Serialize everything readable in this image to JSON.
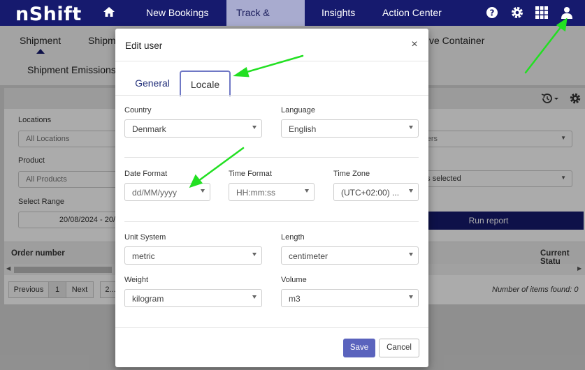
{
  "app": {
    "logo": "nShift"
  },
  "nav": {
    "home_icon": "home-icon",
    "items": [
      {
        "label": "New Bookings"
      },
      {
        "label": "Track & Trace",
        "active": true
      },
      {
        "label": "Insights"
      },
      {
        "label": "Action Center"
      }
    ],
    "right_icons": [
      "help-icon",
      "gear-icon",
      "apps-grid-icon",
      "user-icon"
    ]
  },
  "subnav": {
    "tabs": [
      "Shipment",
      "Shipm",
      "ve Container",
      "Shipment Emissions"
    ]
  },
  "filters": {
    "locations_label": "Locations",
    "locations_value": "All Locations",
    "product_label": "Product",
    "product_value": "All Products",
    "range_label": "Select Range",
    "range_value": "20/08/2024 - 20/",
    "carriers_value": "rriers",
    "items_value": "ms selected",
    "run_label": "Run report"
  },
  "table": {
    "col_order": "Order number",
    "col_status": "Current Statu"
  },
  "pager": {
    "previous": "Previous",
    "page": "1",
    "next": "Next",
    "size": "2...",
    "found": "Number of items found: 0"
  },
  "modal": {
    "title": "Edit user",
    "tabs": {
      "general": "General",
      "locale": "Locale"
    },
    "fields": {
      "country": {
        "label": "Country",
        "value": "Denmark"
      },
      "language": {
        "label": "Language",
        "value": "English"
      },
      "date_format": {
        "label": "Date Format",
        "value": "dd/MM/yyyy"
      },
      "time_format": {
        "label": "Time Format",
        "value": "HH:mm:ss"
      },
      "time_zone": {
        "label": "Time Zone",
        "value": "(UTC+02:00) ..."
      },
      "unit_system": {
        "label": "Unit System",
        "value": "metric"
      },
      "length": {
        "label": "Length",
        "value": "centimeter"
      },
      "weight": {
        "label": "Weight",
        "value": "kilogram"
      },
      "volume": {
        "label": "Volume",
        "value": "m3"
      }
    },
    "save": "Save",
    "cancel": "Cancel"
  },
  "colors": {
    "nav_bg": "#161a6e",
    "accent": "#5a63bd",
    "annotation_arrow": "#22e022"
  }
}
